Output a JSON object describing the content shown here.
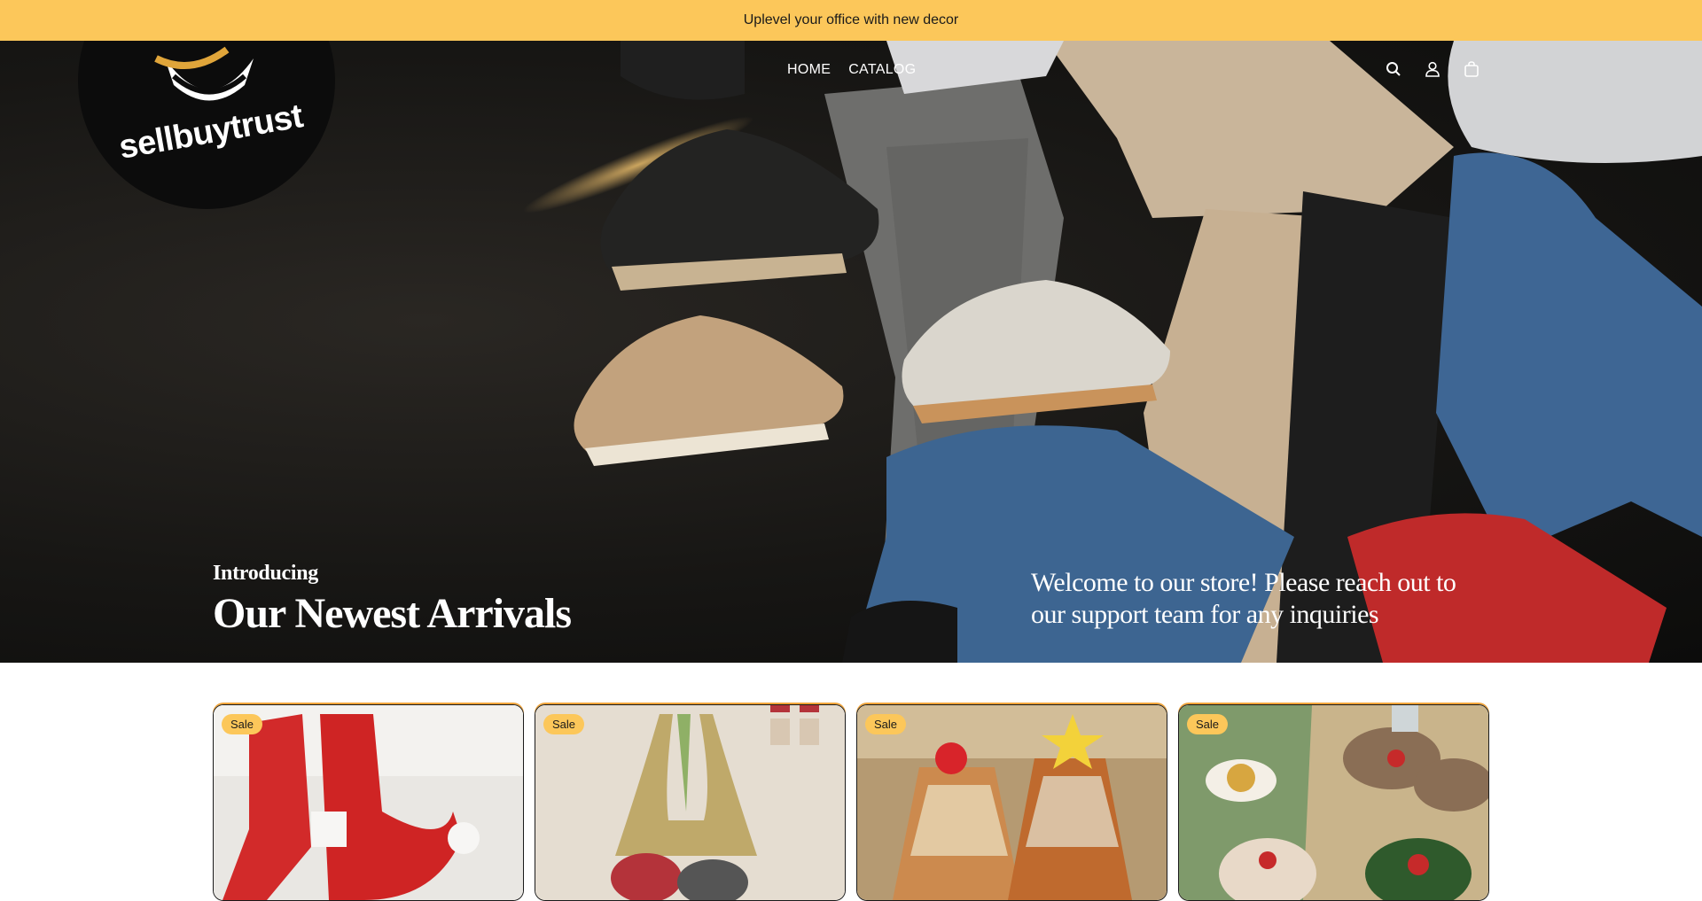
{
  "announcement": {
    "text": "Uplevel your office with new decor"
  },
  "brand": {
    "logo_text": "sellbuytrust"
  },
  "nav": {
    "items": [
      {
        "label": "HOME"
      },
      {
        "label": "CATALOG"
      }
    ]
  },
  "header_icons": [
    "search-icon",
    "account-icon",
    "cart-icon"
  ],
  "hero": {
    "kicker": "Introducing",
    "title": "Our Newest Arrivals",
    "message": "Welcome to our store! Please reach out to our support team for any inquiries"
  },
  "products": [
    {
      "badge": "Sale",
      "image": "red-santa-boots"
    },
    {
      "badge": "Sale",
      "image": "crochet-fish-tote-bag"
    },
    {
      "badge": "Sale",
      "image": "wooden-christmas-trees"
    },
    {
      "badge": "Sale",
      "image": "reindeer-slippers"
    }
  ],
  "colors": {
    "accent": "#fcc75a",
    "hero_bg": "#171614"
  }
}
